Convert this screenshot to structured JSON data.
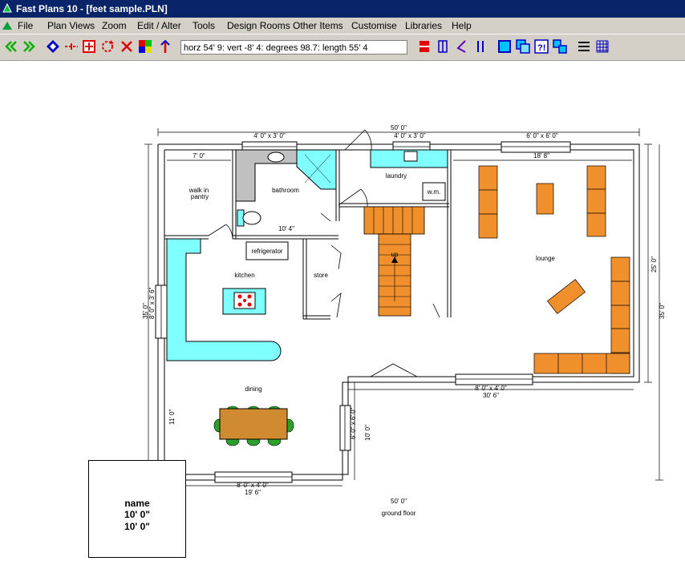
{
  "window": {
    "title": "Fast Plans 10 - [feet sample.PLN]"
  },
  "menu": [
    "File",
    "Plan Views",
    "Zoom",
    "Edit / Alter",
    "Tools",
    "Design Rooms",
    "Other Items",
    "Customise",
    "Libraries",
    "Help"
  ],
  "readout": "horz 54' 9: vert -8' 4: degrees 98.7: length 55' 4",
  "plan": {
    "rooms": {
      "walk_in_pantry_1": "walk in",
      "walk_in_pantry_2": "pantry",
      "bathroom": "bathroom",
      "laundry": "laundry",
      "wm": "w.m.",
      "refrigerator": "refrigerator",
      "kitchen": "kitchen",
      "store": "store",
      "up": "up",
      "lounge": "lounge",
      "dining": "dining",
      "ground_floor": "ground floor"
    },
    "dims": {
      "d_top_overall": "50' 0\"",
      "d_top_w1": "4' 0\" x 3' 0\"",
      "d_top_w2": "4' 0\" x 3' 0\"",
      "d_top_w3": "6' 0\" x 6' 0\"",
      "d_lounge_w": "18' 8\"",
      "d_pantry": "7' 0\"",
      "d_bath": "10' 4\"",
      "d_left_overall": "35' 0\"",
      "d_left_window": "8' 0\" x 3' 6\"",
      "d_dining_h": "11' 0\"",
      "d_mid_window": "6' 0\" x 6' 0\"",
      "d_mid_h": "10' 0\"",
      "d_right_25": "25' 0\"",
      "d_right_35": "35' 0\"",
      "d_lounge_win": "8' 0\" x 4' 0\"",
      "d_30_6": "30' 6\"",
      "d_dining_win": "8' 0\" x 4' 0\"",
      "d_19_6": "19' 6\"",
      "d_bottom_overall": "50' 0\""
    },
    "name_box": {
      "name": "name",
      "w": "10' 0\"",
      "h": "10' 0\""
    }
  },
  "colors": {
    "titlebar": "#0a246a",
    "chrome": "#d4d0c8",
    "counter": "#80ffff",
    "furniture": "#f0902c",
    "wood": "#d08a30",
    "gray": "#c0c0c0",
    "chair": "#2ca02c"
  }
}
